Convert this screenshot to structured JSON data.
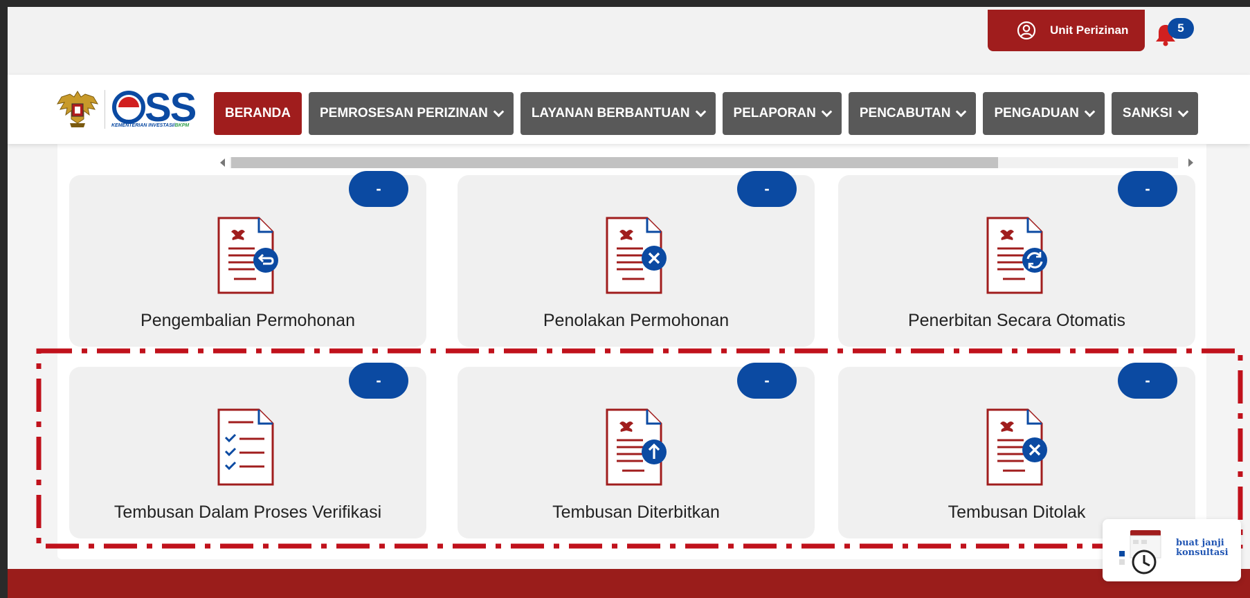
{
  "header": {
    "unit_button_label": "Unit Perizinan",
    "notification_count": "5"
  },
  "logo": {
    "brand": "OSS",
    "subtitle_main": "KEMENTERIAN INVESTASI/",
    "subtitle_accent": "BKPM"
  },
  "nav": {
    "items": [
      {
        "label": "BERANDA",
        "active": true,
        "dropdown": false
      },
      {
        "label": "PEMROSESAN PERIZINAN",
        "active": false,
        "dropdown": true
      },
      {
        "label": "LAYANAN BERBANTUAN",
        "active": false,
        "dropdown": true
      },
      {
        "label": "PELAPORAN",
        "active": false,
        "dropdown": true
      },
      {
        "label": "PENCABUTAN",
        "active": false,
        "dropdown": true
      },
      {
        "label": "PENGADUAN",
        "active": false,
        "dropdown": true
      },
      {
        "label": "SANKSI",
        "active": false,
        "dropdown": true
      }
    ]
  },
  "cards": [
    {
      "label": "Pengembalian Permohonan",
      "count": "-",
      "icon": "doc-return-icon"
    },
    {
      "label": "Penolakan Permohonan",
      "count": "-",
      "icon": "doc-reject-icon"
    },
    {
      "label": "Penerbitan Secara Otomatis",
      "count": "-",
      "icon": "doc-auto-icon"
    },
    {
      "label": "Tembusan Dalam Proses Verifikasi",
      "count": "-",
      "icon": "doc-checklist-icon"
    },
    {
      "label": "Tembusan Diterbitkan",
      "count": "-",
      "icon": "doc-upload-icon"
    },
    {
      "label": "Tembusan Ditolak",
      "count": "-",
      "icon": "doc-reject-icon"
    }
  ],
  "consult": {
    "line1": "buat janji",
    "line2": "konsultasi"
  },
  "colors": {
    "brand_red": "#a01d1d",
    "brand_blue": "#0b4aa2",
    "menu_gray": "#595959",
    "highlight_dash": "#c0111b"
  }
}
